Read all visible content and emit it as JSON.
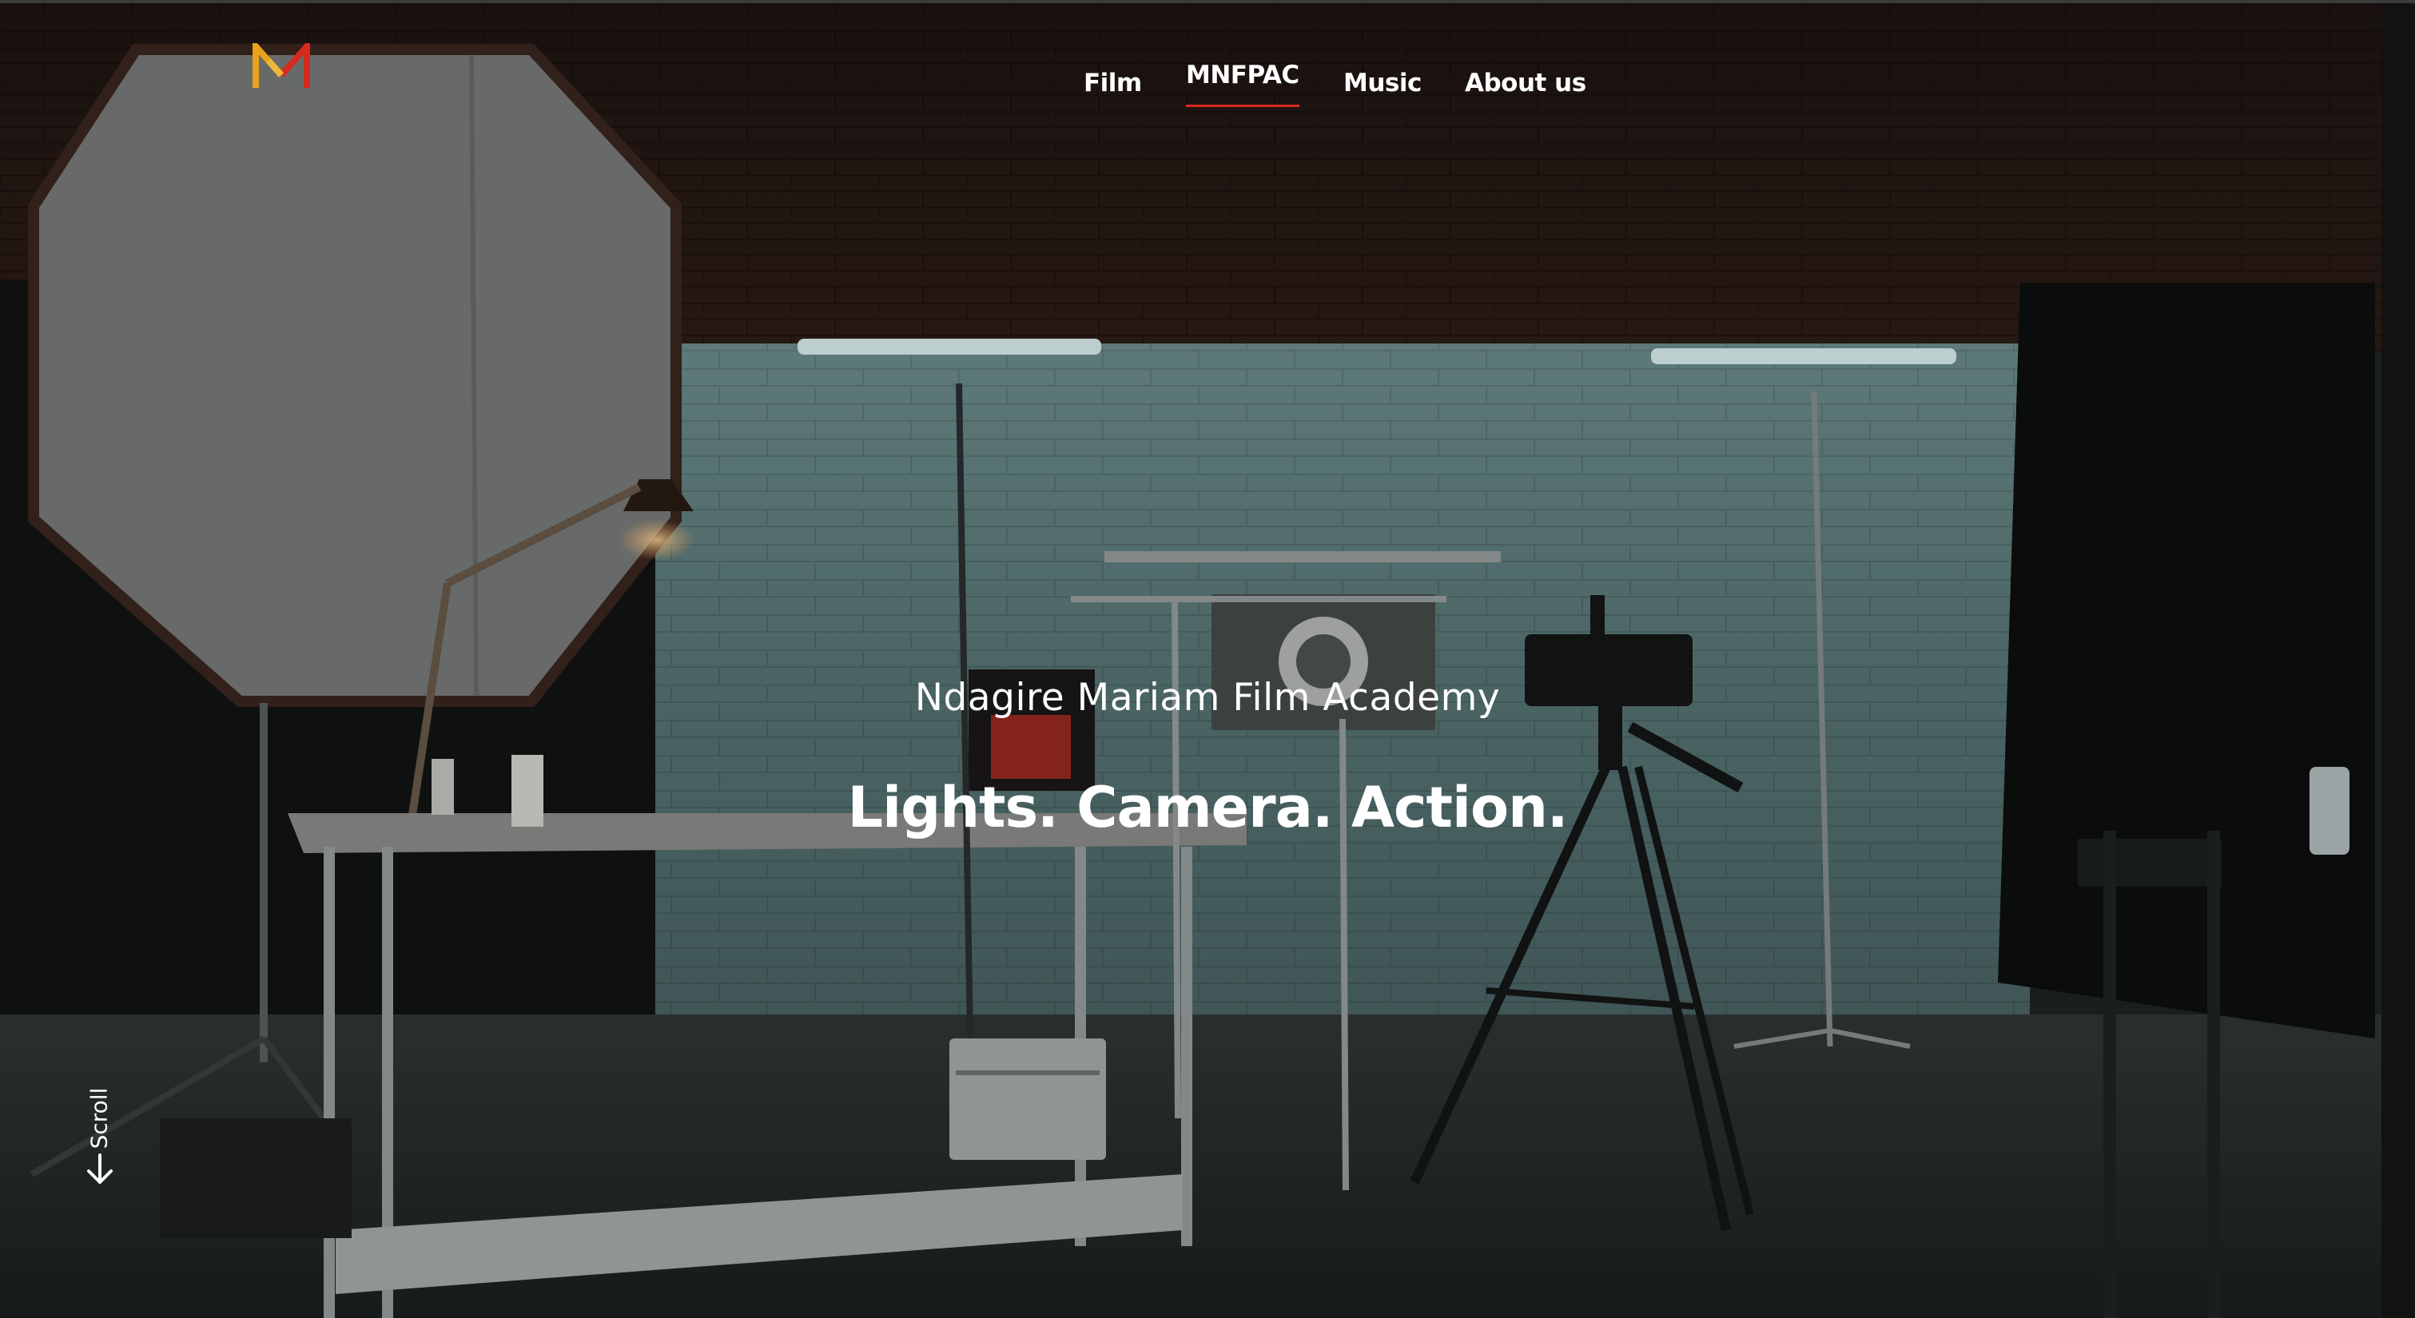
{
  "brand": {
    "logo_letter": "M",
    "logo_colors": [
      "#e8a21c",
      "#d42b1e"
    ]
  },
  "nav": {
    "items": [
      {
        "label": "Film",
        "active": false
      },
      {
        "label": "MNFPAC",
        "active": true
      },
      {
        "label": "Music",
        "active": false
      },
      {
        "label": "About us",
        "active": false
      }
    ]
  },
  "hero": {
    "subtitle": "Ndagire Mariam Film Academy",
    "headline": "Lights. Camera. Action."
  },
  "scroll": {
    "label": "Scroll",
    "icon": "arrow-down-icon"
  },
  "colors": {
    "accent_underline": "#d42b1e",
    "text": "#ffffff"
  }
}
